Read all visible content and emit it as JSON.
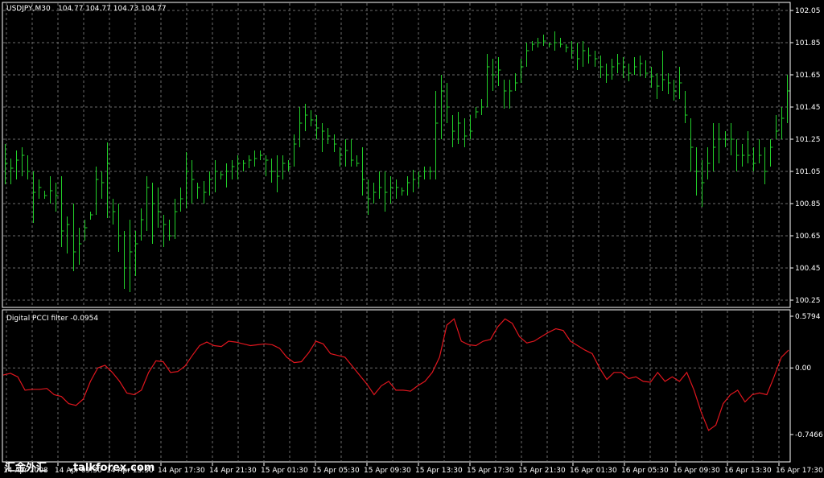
{
  "window": {
    "title": "USDJPY,M30",
    "quote": "104.77 104.77 104.73 104.77"
  },
  "indicator": {
    "title": "Digital PCCI filter -0.0954"
  },
  "watermark": {
    "cjk": "汇金外汇",
    "site": ".talkforex.com"
  },
  "colors": {
    "background": "#000000",
    "grid": "#6b6b6b",
    "bars": "#22d02a",
    "indicator_line": "#e0161e",
    "frame": "#ffffff",
    "text": "#ffffff"
  },
  "price_axis": {
    "ticks": [
      "102.05",
      "101.85",
      "101.65",
      "101.45",
      "101.25",
      "101.05",
      "100.85",
      "100.65",
      "100.45",
      "100.25"
    ]
  },
  "indicator_axis": {
    "ticks": [
      "0.5794",
      "0.00",
      "-0.7466"
    ]
  },
  "time_axis": {
    "ticks": [
      "14 Apr 2008",
      "14 Apr 09:30",
      "14 Apr 13:30",
      "14 Apr 17:30",
      "14 Apr 21:30",
      "15 Apr 01:30",
      "15 Apr 05:30",
      "15 Apr 09:30",
      "15 Apr 13:30",
      "15 Apr 17:30",
      "15 Apr 21:30",
      "16 Apr 01:30",
      "16 Apr 05:30",
      "16 Apr 09:30",
      "16 Apr 13:30",
      "16 Apr 17:30"
    ]
  },
  "chart_data": [
    {
      "type": "ohlc",
      "symbol": "USDJPY",
      "timeframe": "M30",
      "ylim": [
        100.25,
        102.05
      ],
      "bars": [
        {
          "h": 101.22,
          "l": 100.97,
          "c": 101.1
        },
        {
          "h": 101.13,
          "l": 100.97,
          "c": 101.07
        },
        {
          "h": 101.18,
          "l": 101.0,
          "c": 101.12
        },
        {
          "h": 101.2,
          "l": 101.02,
          "c": 101.15
        },
        {
          "h": 101.15,
          "l": 101.0,
          "c": 101.05
        },
        {
          "h": 101.05,
          "l": 100.73,
          "c": 100.92
        },
        {
          "h": 101.0,
          "l": 100.88,
          "c": 100.95
        },
        {
          "h": 100.93,
          "l": 100.88,
          "c": 100.9
        },
        {
          "h": 101.02,
          "l": 100.85,
          "c": 100.93
        },
        {
          "h": 100.98,
          "l": 100.8,
          "c": 100.9
        },
        {
          "h": 101.02,
          "l": 100.58,
          "c": 100.68
        },
        {
          "h": 100.77,
          "l": 100.54,
          "c": 100.72
        },
        {
          "h": 100.85,
          "l": 100.43,
          "c": 100.55
        },
        {
          "h": 100.7,
          "l": 100.47,
          "c": 100.6
        },
        {
          "h": 100.75,
          "l": 100.62,
          "c": 100.7
        },
        {
          "h": 100.8,
          "l": 100.75,
          "c": 100.78
        },
        {
          "h": 101.08,
          "l": 100.78,
          "c": 101.0
        },
        {
          "h": 101.05,
          "l": 100.88,
          "c": 100.98
        },
        {
          "h": 101.23,
          "l": 100.76,
          "c": 101.1
        },
        {
          "h": 100.88,
          "l": 100.72,
          "c": 100.8
        },
        {
          "h": 100.85,
          "l": 100.55,
          "c": 100.65
        },
        {
          "h": 100.68,
          "l": 100.32,
          "c": 100.45
        },
        {
          "h": 100.75,
          "l": 100.3,
          "c": 100.55
        },
        {
          "h": 100.68,
          "l": 100.4,
          "c": 100.6
        },
        {
          "h": 100.82,
          "l": 100.62,
          "c": 100.75
        },
        {
          "h": 101.02,
          "l": 100.68,
          "c": 100.95
        },
        {
          "h": 100.98,
          "l": 100.6,
          "c": 100.85
        },
        {
          "h": 100.95,
          "l": 100.7,
          "c": 100.8
        },
        {
          "h": 100.78,
          "l": 100.58,
          "c": 100.72
        },
        {
          "h": 100.75,
          "l": 100.62,
          "c": 100.65
        },
        {
          "h": 100.88,
          "l": 100.63,
          "c": 100.8
        },
        {
          "h": 100.95,
          "l": 100.8,
          "c": 100.88
        },
        {
          "h": 101.17,
          "l": 100.82,
          "c": 101.05
        },
        {
          "h": 101.12,
          "l": 100.85,
          "c": 101.0
        },
        {
          "h": 100.98,
          "l": 100.88,
          "c": 100.95
        },
        {
          "h": 100.99,
          "l": 100.85,
          "c": 100.92
        },
        {
          "h": 101.05,
          "l": 100.9,
          "c": 101.0
        },
        {
          "h": 101.12,
          "l": 100.92,
          "c": 101.05
        },
        {
          "h": 101.05,
          "l": 101.0,
          "c": 101.03
        },
        {
          "h": 101.1,
          "l": 100.95,
          "c": 101.05
        },
        {
          "h": 101.12,
          "l": 101.0,
          "c": 101.08
        },
        {
          "h": 101.15,
          "l": 101.0,
          "c": 101.1
        },
        {
          "h": 101.12,
          "l": 101.05,
          "c": 101.1
        },
        {
          "h": 101.15,
          "l": 101.07,
          "c": 101.12
        },
        {
          "h": 101.18,
          "l": 101.08,
          "c": 101.13
        },
        {
          "h": 101.18,
          "l": 101.12,
          "c": 101.15
        },
        {
          "h": 101.15,
          "l": 101.02,
          "c": 101.12
        },
        {
          "h": 101.13,
          "l": 100.98,
          "c": 101.05
        },
        {
          "h": 101.15,
          "l": 100.92,
          "c": 101.02
        },
        {
          "h": 101.15,
          "l": 101.0,
          "c": 101.1
        },
        {
          "h": 101.12,
          "l": 101.05,
          "c": 101.08
        },
        {
          "h": 101.28,
          "l": 101.08,
          "c": 101.22
        },
        {
          "h": 101.45,
          "l": 101.2,
          "c": 101.35
        },
        {
          "h": 101.47,
          "l": 101.3,
          "c": 101.4
        },
        {
          "h": 101.43,
          "l": 101.33,
          "c": 101.37
        },
        {
          "h": 101.4,
          "l": 101.25,
          "c": 101.32
        },
        {
          "h": 101.35,
          "l": 101.17,
          "c": 101.3
        },
        {
          "h": 101.32,
          "l": 101.22,
          "c": 101.27
        },
        {
          "h": 101.28,
          "l": 101.17,
          "c": 101.22
        },
        {
          "h": 101.2,
          "l": 101.08,
          "c": 101.15
        },
        {
          "h": 101.25,
          "l": 101.08,
          "c": 101.18
        },
        {
          "h": 101.25,
          "l": 101.08,
          "c": 101.12
        },
        {
          "h": 101.15,
          "l": 101.08,
          "c": 101.1
        },
        {
          "h": 101.2,
          "l": 100.9,
          "c": 101.0
        },
        {
          "h": 101.0,
          "l": 100.78,
          "c": 100.88
        },
        {
          "h": 100.98,
          "l": 100.85,
          "c": 100.92
        },
        {
          "h": 101.05,
          "l": 100.88,
          "c": 100.95
        },
        {
          "h": 101.05,
          "l": 100.8,
          "c": 100.92
        },
        {
          "h": 101.02,
          "l": 100.85,
          "c": 100.95
        },
        {
          "h": 101.0,
          "l": 100.88,
          "c": 100.95
        },
        {
          "h": 100.95,
          "l": 100.9,
          "c": 100.93
        },
        {
          "h": 101.02,
          "l": 100.9,
          "c": 100.98
        },
        {
          "h": 101.06,
          "l": 100.92,
          "c": 101.0
        },
        {
          "h": 101.05,
          "l": 100.95,
          "c": 101.02
        },
        {
          "h": 101.08,
          "l": 101.0,
          "c": 101.05
        },
        {
          "h": 101.08,
          "l": 101.0,
          "c": 101.05
        },
        {
          "h": 101.55,
          "l": 101.0,
          "c": 101.35
        },
        {
          "h": 101.65,
          "l": 101.25,
          "c": 101.55
        },
        {
          "h": 101.6,
          "l": 101.35,
          "c": 101.45
        },
        {
          "h": 101.4,
          "l": 101.2,
          "c": 101.3
        },
        {
          "h": 101.42,
          "l": 101.22,
          "c": 101.35
        },
        {
          "h": 101.38,
          "l": 101.2,
          "c": 101.27
        },
        {
          "h": 101.4,
          "l": 101.25,
          "c": 101.3
        },
        {
          "h": 101.45,
          "l": 101.38,
          "c": 101.42
        },
        {
          "h": 101.5,
          "l": 101.4,
          "c": 101.45
        },
        {
          "h": 101.78,
          "l": 101.45,
          "c": 101.7
        },
        {
          "h": 101.75,
          "l": 101.55,
          "c": 101.65
        },
        {
          "h": 101.76,
          "l": 101.58,
          "c": 101.68
        },
        {
          "h": 101.62,
          "l": 101.44,
          "c": 101.55
        },
        {
          "h": 101.62,
          "l": 101.44,
          "c": 101.55
        },
        {
          "h": 101.66,
          "l": 101.55,
          "c": 101.6
        },
        {
          "h": 101.75,
          "l": 101.6,
          "c": 101.7
        },
        {
          "h": 101.85,
          "l": 101.7,
          "c": 101.8
        },
        {
          "h": 101.86,
          "l": 101.8,
          "c": 101.84
        },
        {
          "h": 101.88,
          "l": 101.82,
          "c": 101.85
        },
        {
          "h": 101.9,
          "l": 101.83,
          "c": 101.86
        },
        {
          "h": 101.85,
          "l": 101.82,
          "c": 101.84
        },
        {
          "h": 101.92,
          "l": 101.8,
          "c": 101.85
        },
        {
          "h": 101.88,
          "l": 101.82,
          "c": 101.84
        },
        {
          "h": 101.84,
          "l": 101.79,
          "c": 101.82
        },
        {
          "h": 101.86,
          "l": 101.75,
          "c": 101.8
        },
        {
          "h": 101.85,
          "l": 101.68,
          "c": 101.75
        },
        {
          "h": 101.86,
          "l": 101.7,
          "c": 101.8
        },
        {
          "h": 101.82,
          "l": 101.72,
          "c": 101.77
        },
        {
          "h": 101.8,
          "l": 101.7,
          "c": 101.75
        },
        {
          "h": 101.77,
          "l": 101.63,
          "c": 101.7
        },
        {
          "h": 101.72,
          "l": 101.6,
          "c": 101.65
        },
        {
          "h": 101.75,
          "l": 101.62,
          "c": 101.7
        },
        {
          "h": 101.78,
          "l": 101.66,
          "c": 101.72
        },
        {
          "h": 101.76,
          "l": 101.63,
          "c": 101.7
        },
        {
          "h": 101.72,
          "l": 101.61,
          "c": 101.66
        },
        {
          "h": 101.76,
          "l": 101.65,
          "c": 101.7
        },
        {
          "h": 101.77,
          "l": 101.64,
          "c": 101.72
        },
        {
          "h": 101.74,
          "l": 101.63,
          "c": 101.66
        },
        {
          "h": 101.7,
          "l": 101.57,
          "c": 101.64
        },
        {
          "h": 101.66,
          "l": 101.5,
          "c": 101.58
        },
        {
          "h": 101.8,
          "l": 101.55,
          "c": 101.62
        },
        {
          "h": 101.66,
          "l": 101.53,
          "c": 101.6
        },
        {
          "h": 101.62,
          "l": 101.49,
          "c": 101.55
        },
        {
          "h": 101.7,
          "l": 101.5,
          "c": 101.6
        },
        {
          "h": 101.55,
          "l": 101.35,
          "c": 101.4
        },
        {
          "h": 101.38,
          "l": 101.05,
          "c": 101.2
        },
        {
          "h": 101.2,
          "l": 100.9,
          "c": 101.05
        },
        {
          "h": 101.12,
          "l": 100.83,
          "c": 100.98
        },
        {
          "h": 101.2,
          "l": 101.0,
          "c": 101.1
        },
        {
          "h": 101.35,
          "l": 101.05,
          "c": 101.2
        },
        {
          "h": 101.35,
          "l": 101.1,
          "c": 101.25
        },
        {
          "h": 101.3,
          "l": 101.2,
          "c": 101.25
        },
        {
          "h": 101.35,
          "l": 101.15,
          "c": 101.25
        },
        {
          "h": 101.25,
          "l": 101.05,
          "c": 101.15
        },
        {
          "h": 101.22,
          "l": 101.08,
          "c": 101.15
        },
        {
          "h": 101.3,
          "l": 101.1,
          "c": 101.15
        },
        {
          "h": 101.2,
          "l": 101.05,
          "c": 101.1
        },
        {
          "h": 101.25,
          "l": 101.1,
          "c": 101.15
        },
        {
          "h": 101.2,
          "l": 100.97,
          "c": 101.05
        },
        {
          "h": 101.25,
          "l": 101.08,
          "c": 101.2
        },
        {
          "h": 101.4,
          "l": 101.25,
          "c": 101.3
        },
        {
          "h": 101.45,
          "l": 101.25,
          "c": 101.38
        },
        {
          "h": 101.65,
          "l": 101.35,
          "c": 101.55
        }
      ]
    },
    {
      "type": "line",
      "series": [
        {
          "name": "Digital PCCI filter",
          "values": [
            -0.08,
            -0.06,
            -0.1,
            -0.25,
            -0.24,
            -0.24,
            -0.23,
            -0.3,
            -0.32,
            -0.4,
            -0.42,
            -0.35,
            -0.15,
            0.0,
            0.03,
            -0.05,
            -0.15,
            -0.28,
            -0.3,
            -0.25,
            -0.05,
            0.08,
            0.07,
            -0.05,
            -0.04,
            0.02,
            0.14,
            0.25,
            0.29,
            0.25,
            0.24,
            0.3,
            0.29,
            0.27,
            0.25,
            0.26,
            0.27,
            0.26,
            0.22,
            0.12,
            0.06,
            0.07,
            0.17,
            0.3,
            0.27,
            0.16,
            0.14,
            0.12,
            0.02,
            -0.08,
            -0.18,
            -0.3,
            -0.2,
            -0.15,
            -0.25,
            -0.25,
            -0.26,
            -0.2,
            -0.15,
            -0.05,
            0.12,
            0.48,
            0.55,
            0.3,
            0.26,
            0.25,
            0.3,
            0.32,
            0.46,
            0.55,
            0.5,
            0.35,
            0.28,
            0.3,
            0.35,
            0.4,
            0.44,
            0.42,
            0.3,
            0.25,
            0.2,
            0.16,
            0.0,
            -0.13,
            -0.05,
            -0.05,
            -0.12,
            -0.1,
            -0.15,
            -0.16,
            -0.05,
            -0.15,
            -0.1,
            -0.15,
            -0.05,
            -0.25,
            -0.5,
            -0.7,
            -0.64,
            -0.4,
            -0.3,
            -0.25,
            -0.38,
            -0.3,
            -0.28,
            -0.3,
            -0.1,
            0.12,
            0.2
          ]
        }
      ],
      "ylim": [
        -0.7466,
        0.5794
      ]
    }
  ]
}
